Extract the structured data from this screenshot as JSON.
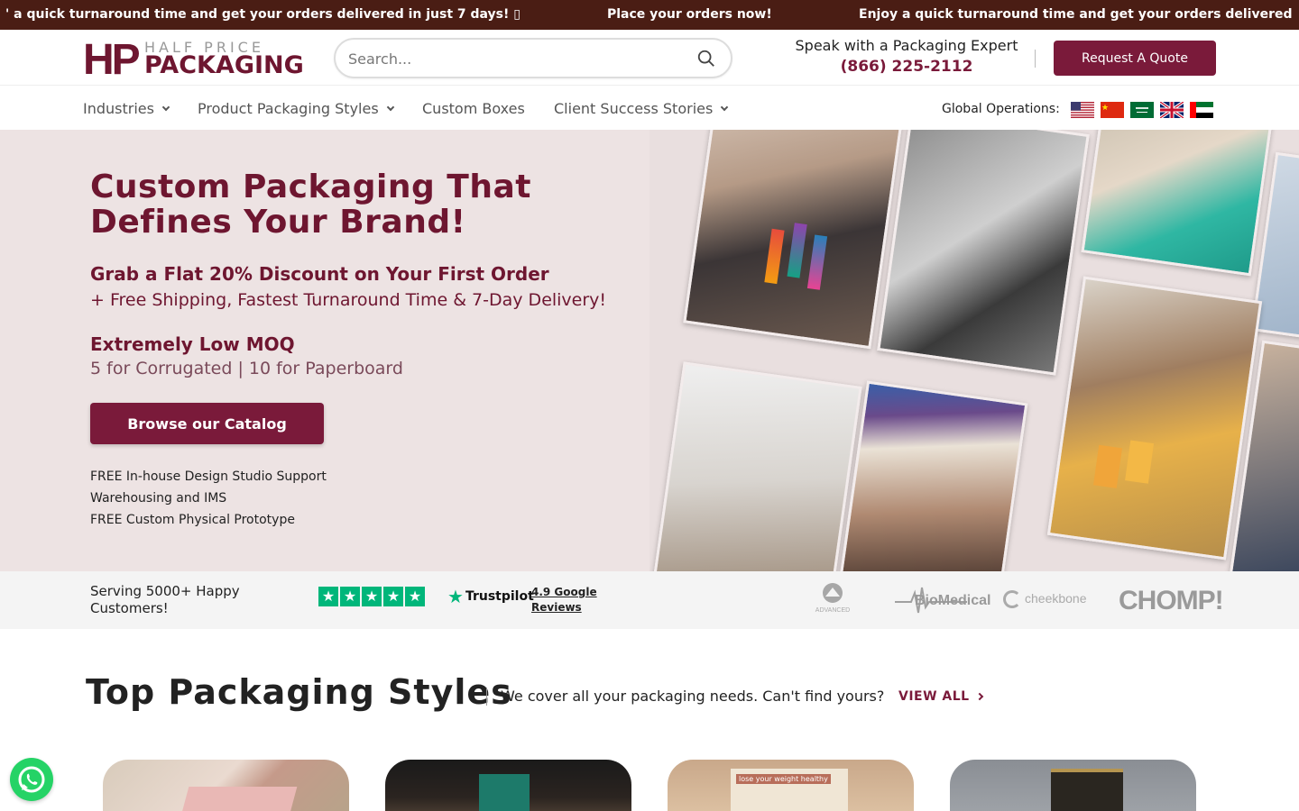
{
  "announcement": {
    "items": [
      "' a quick turnaround time and get your orders delivered in just 7 days! ▯",
      "Place your orders now!",
      "Enjoy a quick turnaround time and get your orders delivered"
    ]
  },
  "header": {
    "logo_hp": "HP",
    "logo_half": "HALF PRICE",
    "logo_packaging": "PACKAGING",
    "search_placeholder": "Search...",
    "expert_label": "Speak with a Packaging Expert",
    "phone": "(866) 225-2112",
    "quote_button": "Request A Quote"
  },
  "nav": {
    "items": [
      "Industries",
      "Product Packaging Styles",
      "Custom Boxes",
      "Client Success Stories"
    ],
    "global_label": "Global Operations:",
    "flags": [
      "us-flag-icon",
      "china-flag-icon",
      "saudi-flag-icon",
      "uk-flag-icon",
      "uae-flag-icon"
    ]
  },
  "hero": {
    "title": "Custom Packaging That Defines Your Brand!",
    "discount": "Grab a Flat 20% Discount on Your First Order",
    "shipping": "+ Free Shipping, Fastest Turnaround Time & 7-Day Delivery!",
    "moq_title": "Extremely Low MOQ",
    "moq_values": "5 for Corrugated | 10 for Paperboard",
    "cta": "Browse our Catalog",
    "features": [
      "FREE In-house Design Studio Support",
      "Warehousing and IMS",
      "FREE Custom Physical Prototype"
    ]
  },
  "trust": {
    "serving": "Serving 5000+ Happy Customers!",
    "trustpilot": "Trustpilot",
    "google": "4.9 Google Reviews",
    "brands": [
      "ADVANCED",
      "BioMedical",
      "cheekbone",
      "CHOMP!"
    ]
  },
  "top_styles": {
    "title": "Top Packaging Styles",
    "subtitle": "We cover all your packaging needs. Can't find yours?",
    "view_all": "VIEW ALL",
    "card3_caption": "lose your weight healthy"
  },
  "colors": {
    "brand": "#7a1a3a",
    "announcement_bg": "#4a1d14",
    "hero_bg": "#ede3e3",
    "trustpilot_green": "#00b67a",
    "whatsapp_green": "#25d366"
  }
}
